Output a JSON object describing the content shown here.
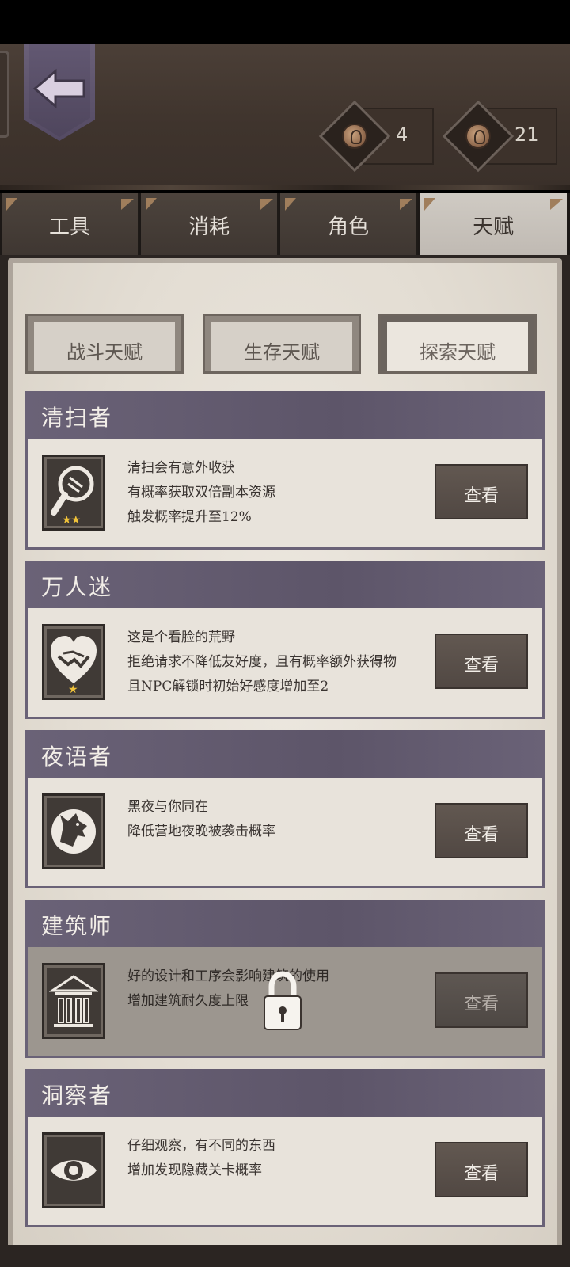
{
  "currency": [
    {
      "value": "4"
    },
    {
      "value": "21"
    }
  ],
  "tabs": [
    {
      "label": "工具"
    },
    {
      "label": "消耗"
    },
    {
      "label": "角色"
    },
    {
      "label": "天赋",
      "active": true
    }
  ],
  "subtabs": [
    {
      "label": "战斗天赋"
    },
    {
      "label": "生存天赋"
    },
    {
      "label": "探索天赋",
      "active": true
    }
  ],
  "talents": [
    {
      "title": "清扫者",
      "lines": [
        "清扫会有意外收获",
        "有概率获取双倍副本资源",
        "触发概率提升至12%"
      ],
      "stars": "★★",
      "button": "查看",
      "icon": "magnifier-icon",
      "locked": false
    },
    {
      "title": "万人迷",
      "lines": [
        "这是个看脸的荒野",
        "拒绝请求不降低友好度，且有概率额外获得物",
        "且NPC解锁时初始好感度增加至2"
      ],
      "stars": "★",
      "button": "查看",
      "icon": "handshake-heart-icon",
      "locked": false
    },
    {
      "title": "夜语者",
      "lines": [
        "黑夜与你同在",
        "降低营地夜晚被袭击概率"
      ],
      "stars": "",
      "button": "查看",
      "icon": "wolf-icon",
      "locked": false
    },
    {
      "title": "建筑师",
      "lines": [
        "好的设计和工序会影响建筑的使用",
        "增加建筑耐久度上限"
      ],
      "stars": "",
      "button": "查看",
      "icon": "building-icon",
      "locked": true
    },
    {
      "title": "洞察者",
      "lines": [
        "仔细观察，有不同的东西",
        "增加发现隐藏关卡概率"
      ],
      "stars": "",
      "button": "查看",
      "icon": "eye-icon",
      "locked": false
    }
  ]
}
